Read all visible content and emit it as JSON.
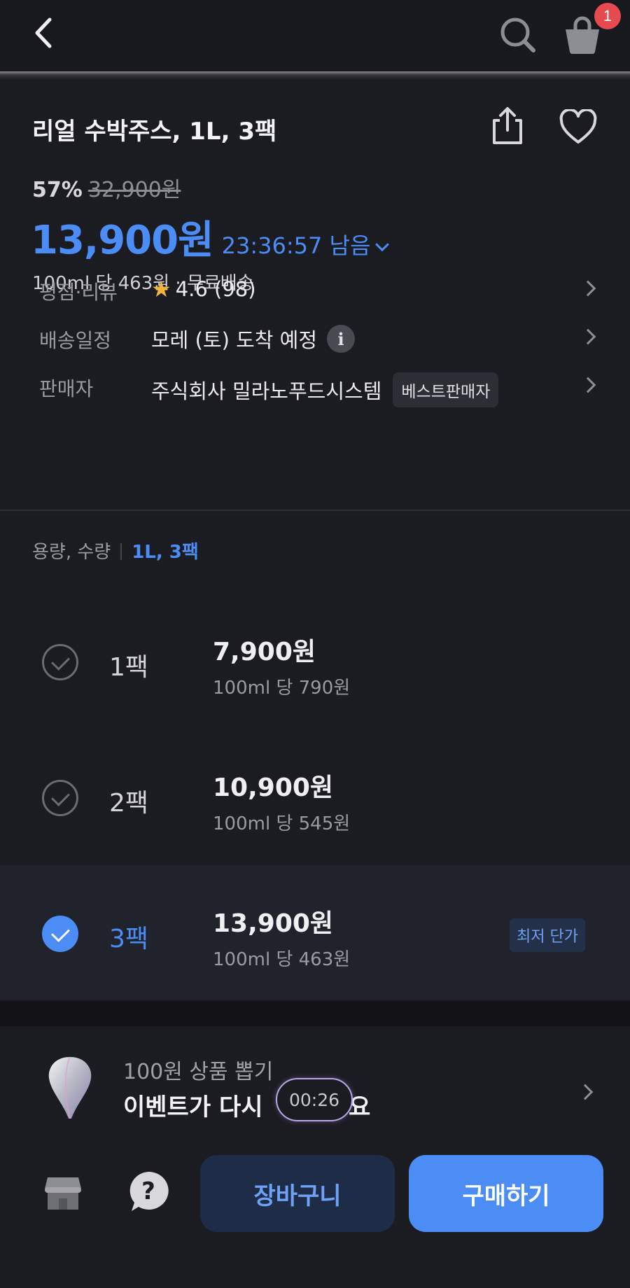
{
  "header": {
    "cart_badge": "1"
  },
  "product": {
    "title": "리얼 수박주스, 1L, 3팩",
    "discount_rate": "57%",
    "original_price": "32,900원",
    "price": "13,900원",
    "timer": "23:36:57 남음",
    "unit_info": "100ml 당 463원 · 무료배송",
    "rating_label": "평점·리뷰",
    "rating_value": "4.6 (98)",
    "delivery_label": "배송일정",
    "delivery_value": "모레 (토) 도착 예정",
    "seller_label": "판매자",
    "seller_value": "주식회사 밀라노푸드시스템",
    "seller_badge": "베스트판매자"
  },
  "options": {
    "header_label": "용량, 수량",
    "header_selected": "1L, 3팩",
    "items": [
      {
        "pack": "1팩",
        "price": "7,900원",
        "unit": "100ml 당 790원",
        "selected": false
      },
      {
        "pack": "2팩",
        "price": "10,900원",
        "unit": "100ml 당 545원",
        "selected": false
      },
      {
        "pack": "3팩",
        "price": "13,900원",
        "unit": "100ml 당 463원",
        "selected": true,
        "badge": "최저 단가"
      }
    ]
  },
  "event": {
    "subtitle": "100원 상품 뽑기",
    "title": "이벤트가 다시",
    "timer": "00:26",
    "title_tail": "요"
  },
  "bottom": {
    "cart_button": "장바구니",
    "buy_button": "구매하기"
  },
  "colors": {
    "accent": "#4b8cf5",
    "background": "#1b1b22",
    "badge_red": "#e44a4f",
    "star": "#f5b53a"
  },
  "icons": [
    "back-arrow-icon",
    "search-icon",
    "shopping-bag-icon",
    "share-icon",
    "heart-icon",
    "star-icon",
    "info-icon",
    "chevron-right-icon",
    "check-circle-icon",
    "balloon-icon",
    "store-icon",
    "help-icon"
  ]
}
